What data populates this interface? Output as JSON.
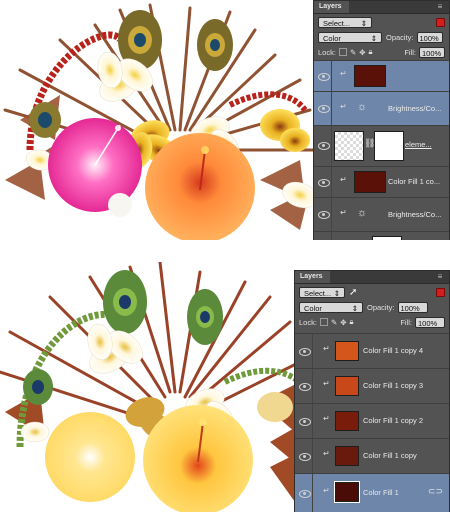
{
  "top_panel": {
    "tab": "Layers",
    "filter": "Select...",
    "blend_mode": "Color",
    "opacity_label": "Opacity:",
    "opacity_value": "100%",
    "lock_label": "Lock:",
    "fill_label": "Fill:",
    "fill_value": "100%",
    "layers": [
      {
        "name": "",
        "type": "color-fill",
        "swatch": "#5a1208",
        "selected": true
      },
      {
        "name": "Brightness/Co...",
        "type": "adjustment",
        "selected": true
      },
      {
        "name": "eleme...",
        "type": "smart-object",
        "selected": false
      },
      {
        "name": "Color Fill 1 co...",
        "type": "color-fill",
        "swatch": "#5a1208",
        "selected": false
      },
      {
        "name": "Brightness/Co...",
        "type": "adjustment",
        "selected": false
      },
      {
        "name": "",
        "type": "partial",
        "selected": false
      }
    ]
  },
  "bottom_panel": {
    "tab": "Layers",
    "filter": "Select...",
    "blend_mode": "Color",
    "opacity_label": "Opacity:",
    "opacity_value": "100%",
    "lock_label": "Lock:",
    "fill_label": "Fill:",
    "fill_value": "100%",
    "layers": [
      {
        "name": "Color Fill 1 copy 4",
        "swatch": "#d4561a",
        "selected": false
      },
      {
        "name": "Color Fill 1 copy 3",
        "swatch": "#c8481a",
        "selected": false
      },
      {
        "name": "Color Fill 1 copy 2",
        "swatch": "#7a1c0c",
        "selected": false
      },
      {
        "name": "Color Fill 1 copy",
        "swatch": "#6a1a0c",
        "selected": false
      },
      {
        "name": "Color Fill 1",
        "swatch": "#4a0c06",
        "selected": true
      }
    ]
  },
  "colors": {
    "panel_bg": "#535353",
    "selected_row": "#6d86a9",
    "accent_red": "#d21e1e"
  }
}
